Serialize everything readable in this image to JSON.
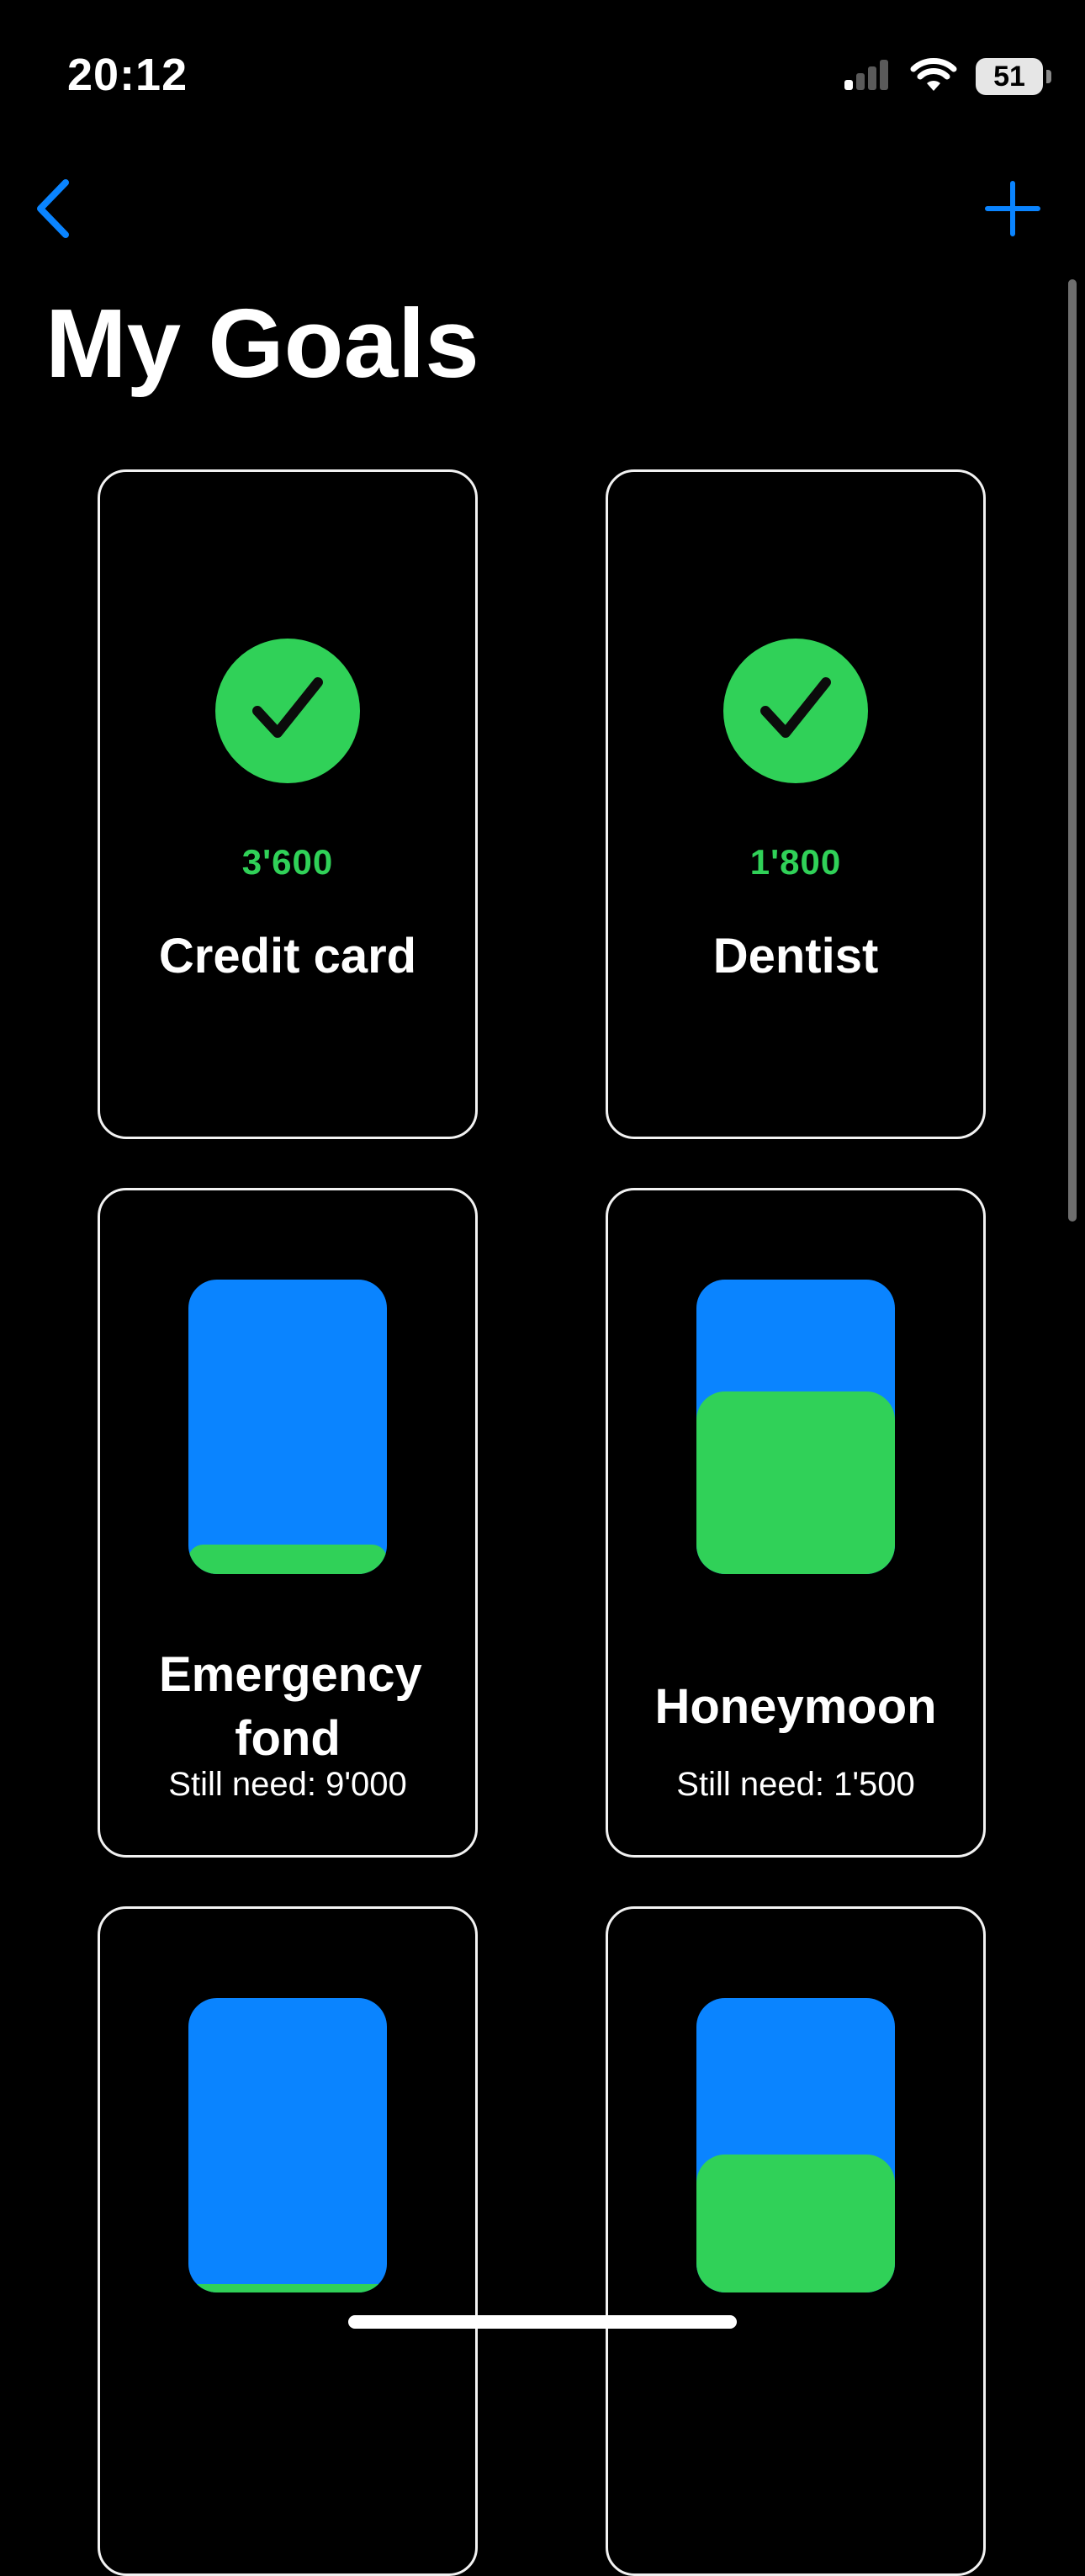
{
  "status_bar": {
    "time": "20:12",
    "signal_icon": "cellular-signal-icon",
    "wifi_icon": "wifi-icon",
    "battery_percent": "51"
  },
  "nav": {
    "back_icon": "chevron-left-icon",
    "add_icon": "plus-icon",
    "accent_color": "#0a84ff"
  },
  "page": {
    "title": "My Goals"
  },
  "colors": {
    "saved": "#30d158",
    "remaining": "#0a84ff"
  },
  "goals": [
    {
      "status": "completed",
      "amount": "3'600",
      "name": "Credit card"
    },
    {
      "status": "completed",
      "amount": "1'800",
      "name": "Dentist"
    },
    {
      "status": "in_progress",
      "name": "Emergency fond",
      "still_need": "Still need: 9'000",
      "progress": 0.1
    },
    {
      "status": "in_progress",
      "name": "Honeymoon",
      "still_need": "Still need: 1'500",
      "progress": 0.62
    },
    {
      "status": "in_progress",
      "progress": 0.03
    },
    {
      "status": "in_progress",
      "progress": 0.47
    }
  ]
}
